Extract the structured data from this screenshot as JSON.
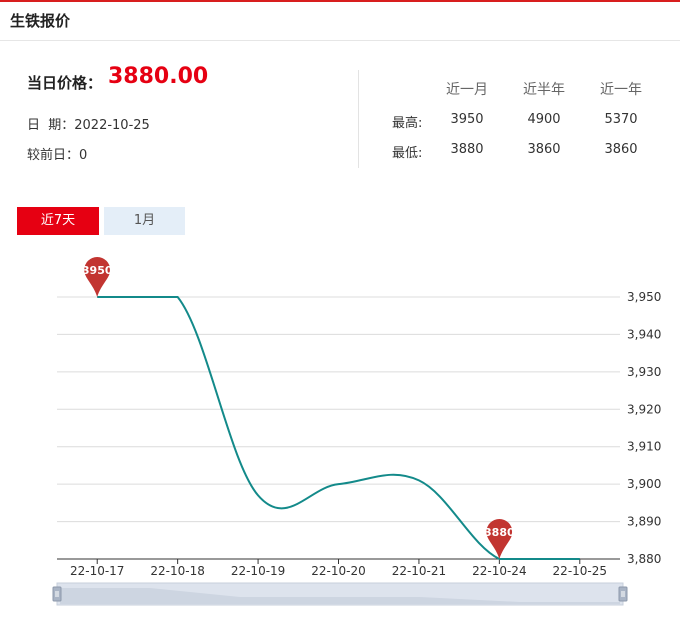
{
  "page_title": "生铁报价",
  "price": {
    "label": "当日价格：",
    "value": "3880.00"
  },
  "date": {
    "label": "日  期：",
    "value": "2022-10-25"
  },
  "change": {
    "label": "较前日：",
    "value": "0"
  },
  "stats": {
    "headers": [
      "近一月",
      "近半年",
      "近一年"
    ],
    "rows": [
      {
        "label": "最高:",
        "values": [
          "3950",
          "4900",
          "5370"
        ]
      },
      {
        "label": "最低:",
        "values": [
          "3880",
          "3860",
          "3860"
        ]
      }
    ]
  },
  "tabs": [
    {
      "label": "近7天",
      "active": true
    },
    {
      "label": "1月",
      "active": false
    }
  ],
  "colors": {
    "accent": "#e60012",
    "line": "#138a8a",
    "marker": "#c23531",
    "tab_inactive": "#e4eef8"
  },
  "chart_data": {
    "type": "line",
    "categories": [
      "22-10-17",
      "22-10-18",
      "22-10-19",
      "22-10-20",
      "22-10-21",
      "22-10-24",
      "22-10-25"
    ],
    "values": [
      3950,
      3950,
      3897,
      3900,
      3901,
      3880,
      3880
    ],
    "ylim": [
      3880,
      3950
    ],
    "yticks": [
      3880,
      3890,
      3900,
      3910,
      3920,
      3930,
      3940,
      3950
    ],
    "ytick_labels": [
      "3,880",
      "3,890",
      "3,900",
      "3,910",
      "3,920",
      "3,930",
      "3,940",
      "3,950"
    ],
    "y_axis_position": "right",
    "grid": true,
    "smooth": true,
    "markers": [
      {
        "category": "22-10-17",
        "value": 3950,
        "label": "3950"
      },
      {
        "category": "22-10-24",
        "value": 3880,
        "label": "3880"
      }
    ],
    "data_zoom": true
  }
}
